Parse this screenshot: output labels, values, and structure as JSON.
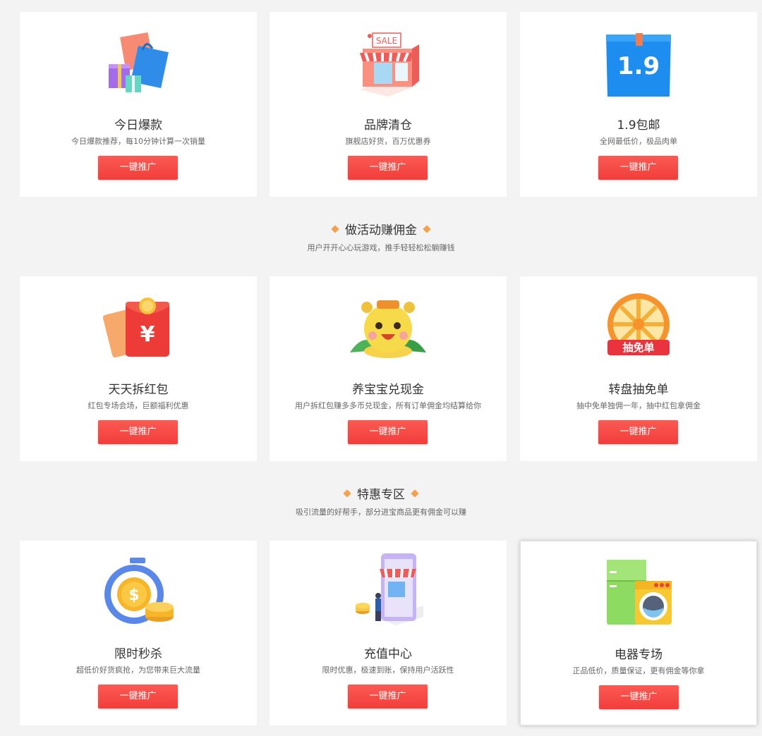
{
  "sections": [
    {
      "cards": [
        {
          "title": "今日爆款",
          "desc": "今日爆款推荐，每10分钟计算一次销量",
          "button": "一键推广",
          "icon": "shopping-bags-icon"
        },
        {
          "title": "品牌清仓",
          "desc": "旗舰店好货，百万优惠券",
          "button": "一键推广",
          "icon": "sale-store-icon",
          "icon_text": "SALE"
        },
        {
          "title": "1.9包邮",
          "desc": "全网最低价，极品肉单",
          "button": "一键推广",
          "icon": "box-1-9-icon",
          "icon_text": "1.9"
        }
      ]
    },
    {
      "heading": "做活动赚佣金",
      "subheading": "用户开开心心玩游戏，推手轻轻松松躺赚钱",
      "cards": [
        {
          "title": "天天拆红包",
          "desc": "红包专场会场，巨额福利优惠",
          "button": "一键推广",
          "icon": "red-envelope-icon",
          "icon_text": "¥"
        },
        {
          "title": "养宝宝兑现金",
          "desc": "用户拆红包赚多多币兑现金，所有订单佣金均结算给你",
          "button": "一键推广",
          "icon": "baby-mascot-icon"
        },
        {
          "title": "转盘抽免单",
          "desc": "抽中免单独佣一年，抽中红包拿佣金",
          "button": "一键推广",
          "icon": "lucky-wheel-icon",
          "icon_text": "抽免单"
        }
      ]
    },
    {
      "heading": "特惠专区",
      "subheading": "吸引流量的好帮手，部分进宝商品更有佣金可以赚",
      "cards": [
        {
          "title": "限时秒杀",
          "desc": "超低价好货疯抢，为您带来巨大流量",
          "button": "一键推广",
          "icon": "stopwatch-coins-icon",
          "icon_text": "$"
        },
        {
          "title": "充值中心",
          "desc": "限时优惠，极速到账，保持用户活跃性",
          "button": "一键推广",
          "icon": "phone-shop-icon"
        },
        {
          "title": "电器专场",
          "desc": "正品低价，质量保证，更有佣金等你拿",
          "button": "一键推广",
          "icon": "appliances-icon"
        }
      ]
    }
  ],
  "colors": {
    "background": "#f3f3f3",
    "button": "#f5423f",
    "diamond": "#f5a04a"
  }
}
